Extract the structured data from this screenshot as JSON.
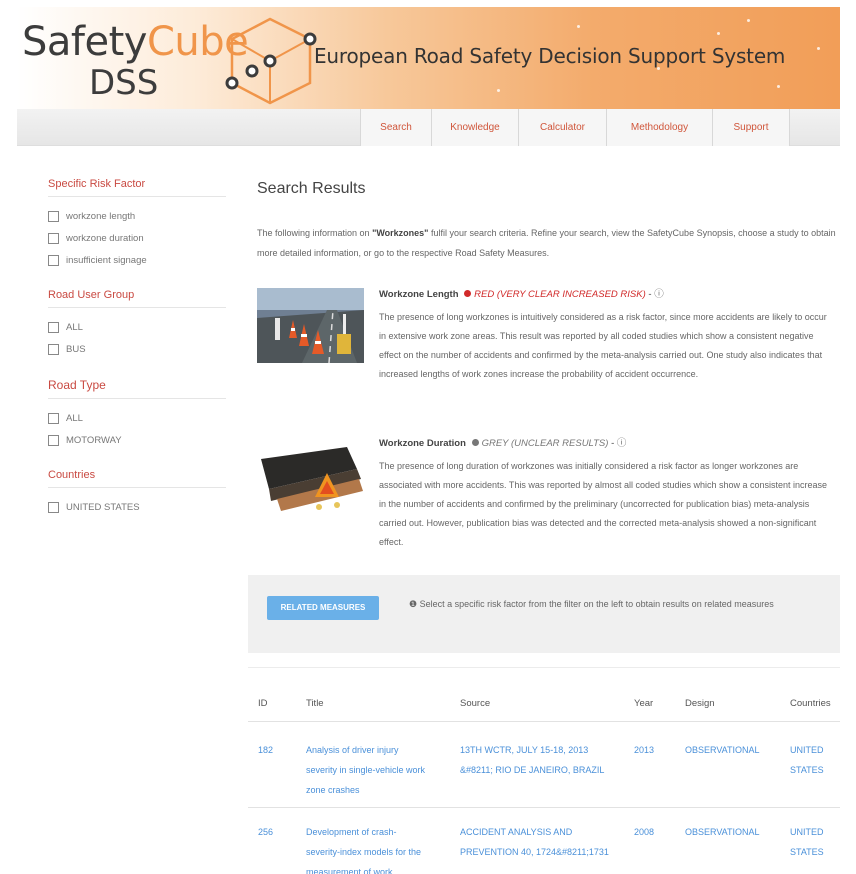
{
  "header": {
    "logo_word1": "Safety",
    "logo_word2": "Cube",
    "logo_line2": "DSS",
    "title": "European Road Safety Decision Support System"
  },
  "nav": {
    "items": [
      "Search",
      "Knowledge",
      "Calculator",
      "Methodology",
      "Support"
    ]
  },
  "sidebar": {
    "groups": [
      {
        "title": "Specific Risk Factor",
        "options": [
          "workzone length",
          "workzone duration",
          "insufficient signage"
        ]
      },
      {
        "title": "Road User Group",
        "options": [
          "ALL",
          "BUS"
        ]
      },
      {
        "title": "Road Type",
        "options": [
          "ALL",
          "MOTORWAY"
        ]
      },
      {
        "title": "Countries",
        "options": [
          "UNITED STATES"
        ]
      }
    ]
  },
  "main": {
    "title": "Search Results",
    "intro_pre": "The following information on ",
    "intro_term": "\"Workzones\"",
    "intro_post": " fulfil your search criteria. Refine your search, view the SafetyCube Synopsis, choose a study to obtain more detailed information, or go to the respective Road Safety Measures."
  },
  "results": [
    {
      "name": "Workzone Length",
      "status_label": "RED (VERY CLEAR INCREASED RISK)",
      "status_color": "#d12a2a",
      "info": "ⓘ",
      "text": "The presence of long workzones is intuitively considered as a risk factor, since more accidents are likely to occur in extensive work zone areas. This result was reported by all coded studies which show a consistent negative effect on the number of accidents and confirmed by the meta-analysis carried out. One study also indicates that increased lengths of work zones increase the probability of accident occurrence."
    },
    {
      "name": "Workzone Duration",
      "status_label": "GREY (UNCLEAR RESULTS)",
      "status_color": "#777777",
      "info": "ⓘ",
      "text": "The presence of long duration of workzones was initially considered a risk factor as longer workzones are associated with more accidents. This was reported by almost all coded studies which show a consistent increase in the number of accidents and confirmed by the preliminary (uncorrected for publication bias) meta-analysis carried out. However, publication bias was detected and the corrected meta-analysis showed a non-significant effect."
    }
  ],
  "related": {
    "button": "RELATED MEASURES",
    "note": "❶ Select a specific risk factor from the filter on the left to obtain results on related measures"
  },
  "table": {
    "headers": [
      "ID",
      "Title",
      "Source",
      "Year",
      "Design",
      "Countries"
    ],
    "rows": [
      {
        "id": "182",
        "title": "Analysis of driver injury severity in single-vehicle work zone crashes",
        "source": "13TH WCTR, JULY 15-18, 2013 &#8211; RIO DE JANEIRO, BRAZIL",
        "year": "2013",
        "design": "OBSERVATIONAL",
        "country": "UNITED STATES"
      },
      {
        "id": "256",
        "title": "Development of crash-severity-index models for the measurement of work",
        "source": "ACCIDENT ANALYSIS AND PREVENTION 40, 1724&#8211;1731",
        "year": "2008",
        "design": "OBSERVATIONAL",
        "country": "UNITED STATES"
      }
    ]
  }
}
